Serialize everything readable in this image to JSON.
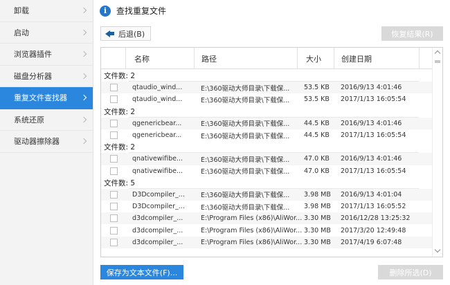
{
  "sidebar": {
    "items": [
      {
        "label": "卸载",
        "active": false
      },
      {
        "label": "启动",
        "active": false
      },
      {
        "label": "浏览器插件",
        "active": false
      },
      {
        "label": "磁盘分析器",
        "active": false
      },
      {
        "label": "重复文件查找器",
        "active": true
      },
      {
        "label": "系统还原",
        "active": false
      },
      {
        "label": "驱动器擦除器",
        "active": false
      }
    ]
  },
  "header": {
    "icon": "info-icon",
    "title": "查找重复文件"
  },
  "toolbar": {
    "back_label": "后退(B)",
    "restore_label": "恢复结果(R)"
  },
  "table": {
    "columns": [
      "名称",
      "路径",
      "大小",
      "创建日期"
    ],
    "groups": [
      {
        "label": "文件数: 2",
        "files": [
          {
            "name": "qtaudio_wind...",
            "path": "E:\\360驱动大师目录\\下载保...",
            "size": "53.5 KB",
            "date": "2016/9/13 4:01:46"
          },
          {
            "name": "qtaudio_wind...",
            "path": "E:\\360驱动大师目录\\下载保...",
            "size": "53.5 KB",
            "date": "2017/1/13 16:05:54"
          }
        ]
      },
      {
        "label": "文件数: 2",
        "files": [
          {
            "name": "qgenericbear...",
            "path": "E:\\360驱动大师目录\\下载保...",
            "size": "44.5 KB",
            "date": "2016/9/13 4:01:46"
          },
          {
            "name": "qgenericbear...",
            "path": "E:\\360驱动大师目录\\下载保...",
            "size": "44.5 KB",
            "date": "2017/1/13 16:05:54"
          }
        ]
      },
      {
        "label": "文件数: 2",
        "files": [
          {
            "name": "qnativewifibe...",
            "path": "E:\\360驱动大师目录\\下载保...",
            "size": "47.0 KB",
            "date": "2016/9/13 4:01:46"
          },
          {
            "name": "qnativewifibe...",
            "path": "E:\\360驱动大师目录\\下载保...",
            "size": "47.0 KB",
            "date": "2017/1/13 16:05:54"
          }
        ]
      },
      {
        "label": "文件数: 5",
        "files": [
          {
            "name": "D3Dcompiler_...",
            "path": "E:\\360驱动大师目录\\下载保...",
            "size": "3.98 MB",
            "date": "2016/9/13 4:01:04"
          },
          {
            "name": "D3Dcompiler_...",
            "path": "E:\\360驱动大师目录\\下载保...",
            "size": "3.98 MB",
            "date": "2017/1/13 16:05:52"
          },
          {
            "name": "d3dcompiler_...",
            "path": "E:\\Program Files (x86)\\AliWor...",
            "size": "3.30 MB",
            "date": "2016/12/28 13:25:32"
          },
          {
            "name": "d3dcompiler_...",
            "path": "E:\\Program Files (x86)\\AliWor...",
            "size": "3.30 MB",
            "date": "2017/3/20 12:49:48"
          },
          {
            "name": "d3dcompiler_...",
            "path": "E:\\Program Files (x86)\\AliWor...",
            "size": "3.30 MB",
            "date": "2017/4/19 6:07:48"
          }
        ]
      }
    ]
  },
  "footer": {
    "save_label": "保存为文本文件(F)...",
    "delete_label": "删除所选(D)"
  }
}
